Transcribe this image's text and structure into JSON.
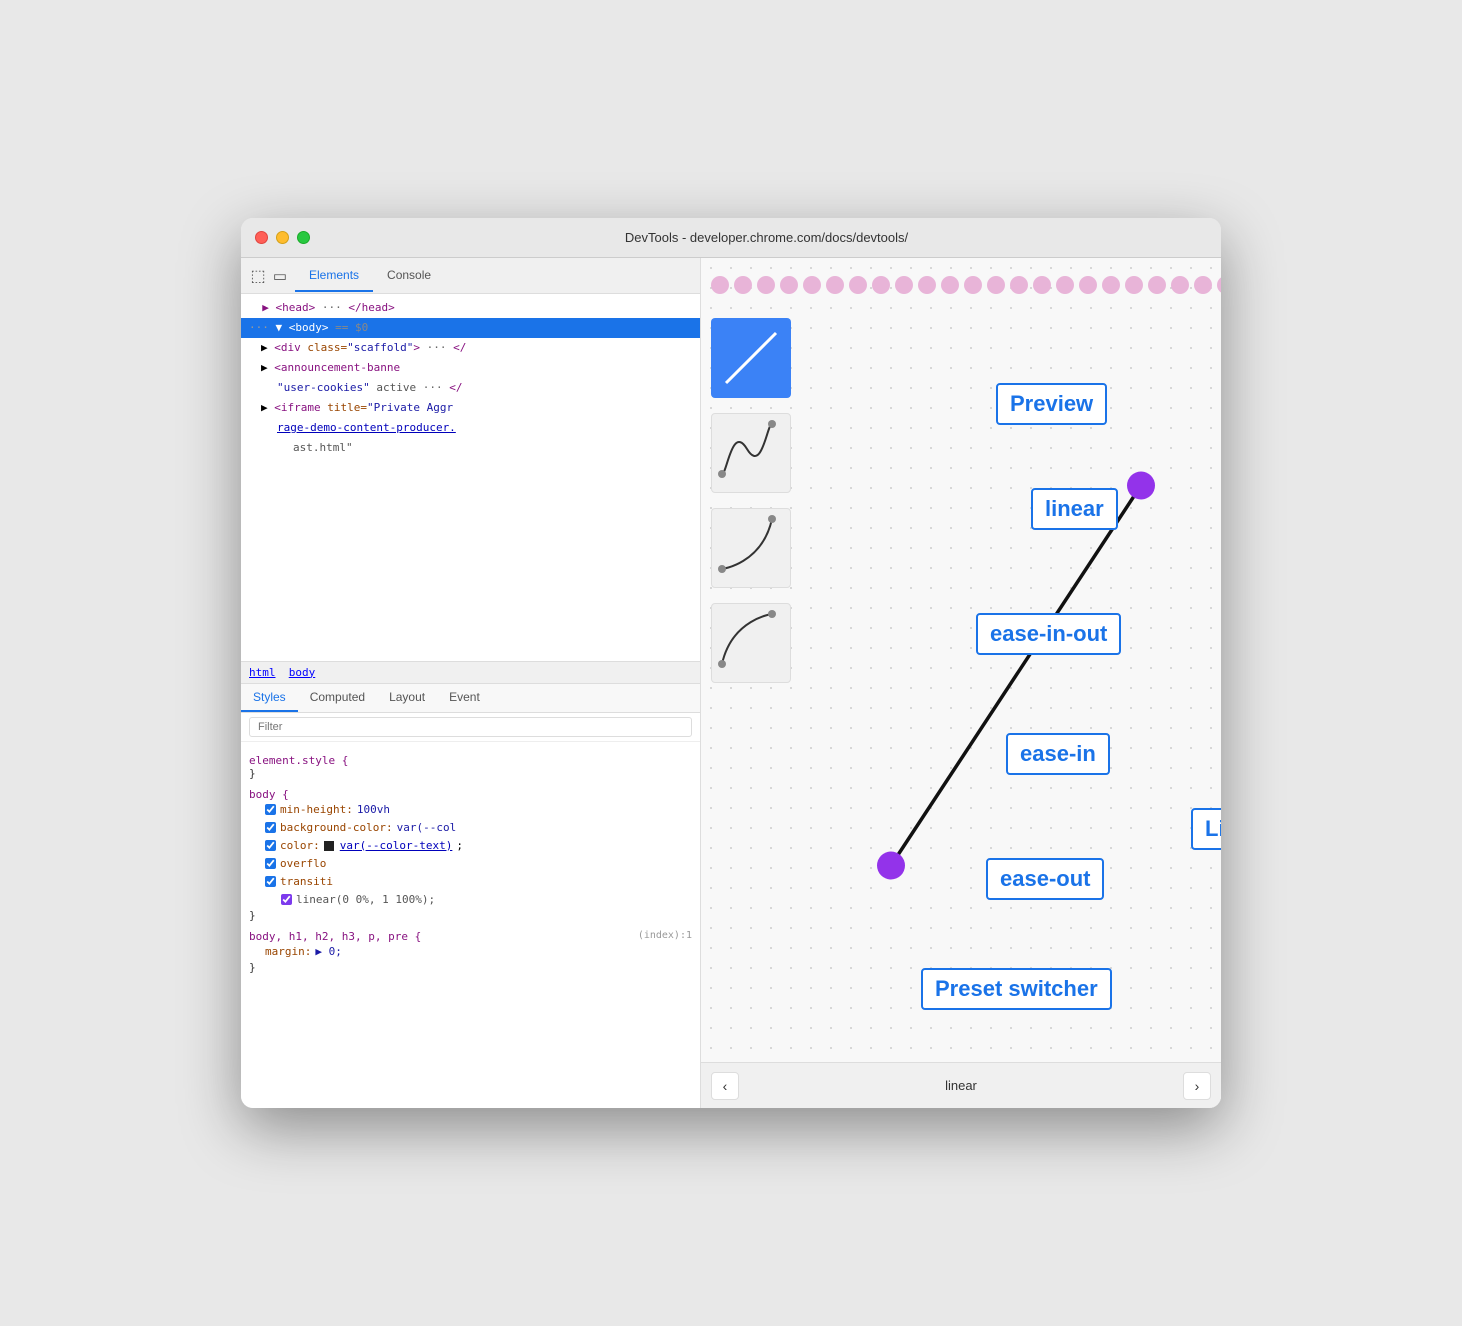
{
  "window": {
    "title": "DevTools - developer.chrome.com/docs/devtools/"
  },
  "tabs": {
    "elements_label": "Elements",
    "console_label": "Console"
  },
  "styles_tabs": {
    "styles_label": "Styles",
    "computed_label": "Computed",
    "layout_label": "Layout",
    "event_label": "Event"
  },
  "filter": {
    "placeholder": "Filter"
  },
  "dom": {
    "head_line": "▶ <head> ··· </head>",
    "body_line": "··· ▼ <body> == $0",
    "div_scaffold": "▶ <div class=\"scaffold\"> ··· </",
    "announcement": "▶ <announcement-banne",
    "user_cookies": "  \"user-cookies\" active ··· </",
    "iframe": "▶ <iframe title=\"Private Aggr",
    "rage_demo": "rage-demo-content-producer.",
    "ast_html": "ast.html\""
  },
  "breadcrumb": {
    "html": "html",
    "body": "body"
  },
  "css_rules": [
    {
      "selector": "element.style {",
      "close": "}"
    },
    {
      "selector": "body {",
      "props": [
        {
          "prop": "min-height:",
          "val": "100vh",
          "checked": true
        },
        {
          "prop": "background-color:",
          "val": "var(--col",
          "checked": true
        },
        {
          "prop": "color:",
          "val": "var(--color-text);",
          "checked": true,
          "has_swatch": true
        },
        {
          "prop": "overflo",
          "val": "",
          "checked": true
        },
        {
          "prop": "transiti",
          "val": "",
          "checked": true
        },
        {
          "prop_indent": "linear(0 0%, 1 100%);",
          "checked": true
        }
      ],
      "close": "}"
    },
    {
      "selector": "body, h1, h2, h3, p, pre {",
      "props": [
        {
          "prop": "margin:",
          "val": "▶ 0;"
        }
      ],
      "source": "(index):1",
      "close": "}"
    }
  ],
  "preview": {
    "callouts": {
      "preview": "Preview",
      "linear": "linear",
      "ease_inout": "ease-in-out",
      "ease_in": "ease-in",
      "ease_out": "ease-out",
      "preset_switcher": "Preset switcher",
      "line_editor": "Line editor"
    },
    "bottom": {
      "prev_label": "‹",
      "next_label": "›",
      "current": "linear"
    }
  }
}
